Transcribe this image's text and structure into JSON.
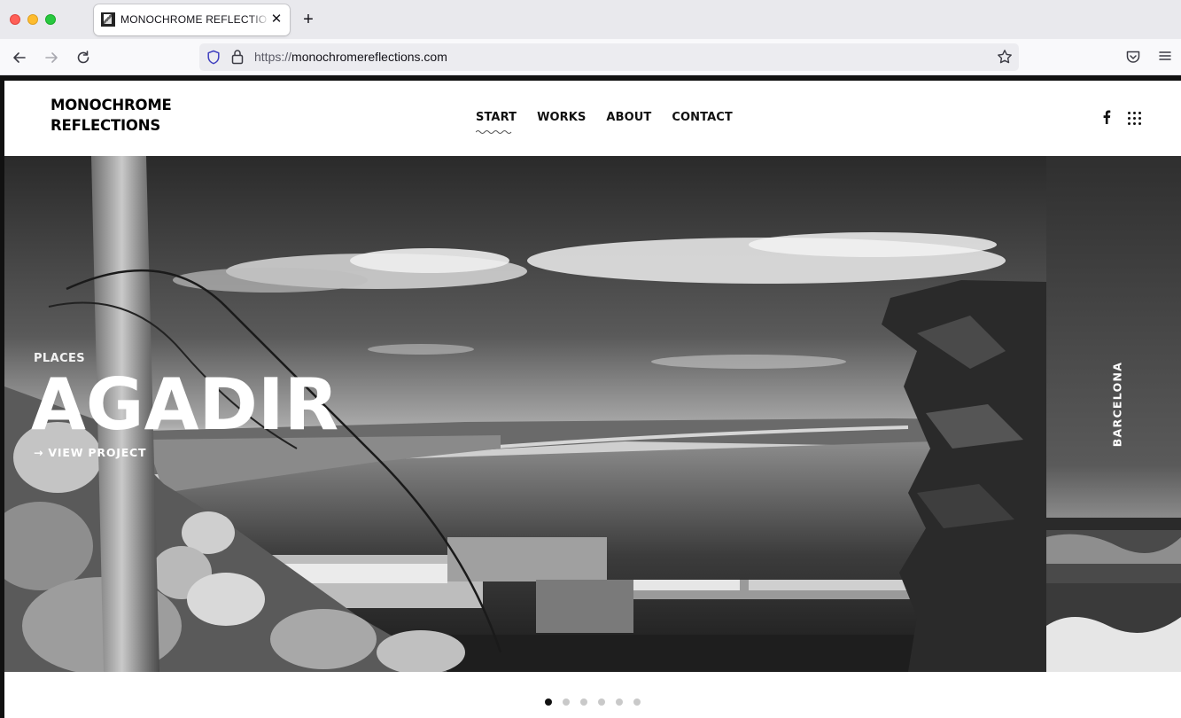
{
  "browser": {
    "tab_title": "MONOCHROME REFLECTIONS | Photography",
    "url_protocol": "https://",
    "url_host": "monochromereflections.com"
  },
  "site": {
    "logo_line1": "MONOCHROME",
    "logo_line2": "REFLECTIONS",
    "nav": [
      "START",
      "WORKS",
      "ABOUT",
      "CONTACT"
    ],
    "active_nav": "START"
  },
  "hero": {
    "category": "PLACES",
    "title": "AGADIR",
    "link": "→ VIEW PROJECT",
    "next_slide": "BARCELONA"
  },
  "slider": {
    "count": 6,
    "active_index": 0
  },
  "icons": {
    "back": "arrow-left-icon",
    "forward": "arrow-right-icon",
    "reload": "reload-icon",
    "shield": "shield-icon",
    "lock": "lock-icon",
    "bookmark": "star-icon",
    "pocket": "pocket-icon",
    "menu": "hamburger-menu-icon",
    "facebook": "facebook-icon",
    "apps": "grid-dots-icon"
  }
}
